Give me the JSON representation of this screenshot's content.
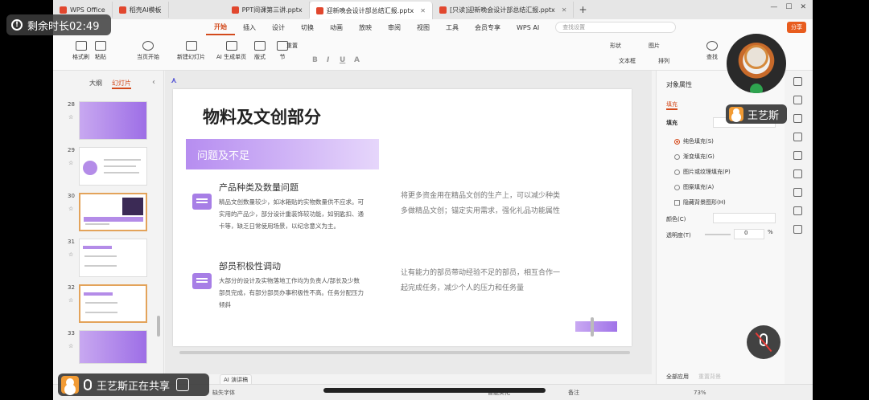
{
  "timer": {
    "label": "剩余时长02:49"
  },
  "tabs": [
    {
      "label": "WPS Office"
    },
    {
      "label": "稻壳AI模板"
    },
    {
      "label": "PPT间课第三讲.pptx"
    },
    {
      "label": "迎新晚会设计部总结汇报.pptx"
    },
    {
      "label": "[只读]迎新晚会设计部总结汇报.pptx"
    }
  ],
  "menu": [
    "开始",
    "插入",
    "设计",
    "切换",
    "动画",
    "放映",
    "审阅",
    "视图",
    "工具",
    "会员专享",
    "WPS AI"
  ],
  "search_placeholder": "查找设置",
  "share_label": "分享",
  "toolbar": {
    "format_painter": "格式刷",
    "paste": "粘贴",
    "from_current": "当页开始",
    "new_slide": "新建幻灯片",
    "ai_single": "AI 生成单页",
    "layout": "版式",
    "section": "节",
    "reset": "重置",
    "shape": "形状",
    "picture": "图片",
    "textbox": "文本框",
    "arrange": "排列",
    "find": "查找"
  },
  "left_panel": {
    "tab_outline": "大纲",
    "tab_slides": "幻灯片",
    "slide_numbers": [
      "28",
      "29",
      "30",
      "31",
      "32",
      "33"
    ]
  },
  "slide": {
    "title": "物料及文创部分",
    "banner": "问题及不足",
    "sec1_title": "产品种类及数量问题",
    "sec1_body": "精品文创数量较少，如冰箱贴的实物数量供不应求。可实用的产品少，部分设计重装饰较功能，如钥匙扣、通卡等，缺乏日常使用场景，以纪念意义为主。",
    "sec1_right": "将更多资金用在精品文创的生产上，可以减少种类多做精品文创；锚定实用需求，强化礼品功能属性",
    "sec2_title": "部员积极性调动",
    "sec2_body": "大部分的设计及实物落地工作均为负责人/部长及少数部员完成，有部分部员办事积极性不高。任务分配压力倾斜",
    "sec2_right": "让有能力的部员带动经验不足的部员，相互合作一起完成任务，减少个人的压力和任务量"
  },
  "right_panel": {
    "title": "对象属性",
    "tab": "填充",
    "section": "填充",
    "options": [
      "纯色填充(S)",
      "渐变填充(G)",
      "图片或纹理填充(P)",
      "图案填充(A)",
      "隐藏背景图形(H)"
    ],
    "color_label": "颜色(C)",
    "transparency_label": "透明度(T)",
    "transparency_value": "0",
    "percent": "%",
    "apply_all": "全部应用",
    "reset_bg": "重置背景"
  },
  "statusbar": {
    "font_missing": "缺失字体",
    "beautify": "智能美化",
    "notes": "备注",
    "zoom": "73%"
  },
  "ai_note": "AI 演讲稿",
  "sharing": {
    "text": "王艺斯正在共享"
  },
  "participant": {
    "name": "王艺斯"
  }
}
